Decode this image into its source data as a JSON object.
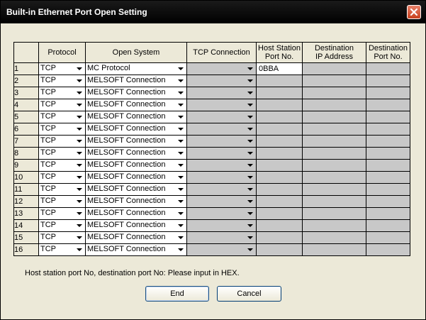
{
  "window": {
    "title": "Built-in Ethernet Port Open Setting"
  },
  "columns": {
    "num": "",
    "protocol": "Protocol",
    "open_system": "Open System",
    "tcp_connection": "TCP Connection",
    "host_port_line1": "Host Station",
    "host_port_line2": "Port No.",
    "dest_ip_line1": "Destination",
    "dest_ip_line2": "IP Address",
    "dest_port_line1": "Destination",
    "dest_port_line2": "Port No."
  },
  "rows": [
    {
      "num": "1",
      "protocol": "TCP",
      "open_system": "MC Protocol",
      "tcp_connection": "",
      "host_port": "0BBA",
      "dest_ip": "",
      "dest_port": ""
    },
    {
      "num": "2",
      "protocol": "TCP",
      "open_system": "MELSOFT Connection",
      "tcp_connection": "",
      "host_port": "",
      "dest_ip": "",
      "dest_port": ""
    },
    {
      "num": "3",
      "protocol": "TCP",
      "open_system": "MELSOFT Connection",
      "tcp_connection": "",
      "host_port": "",
      "dest_ip": "",
      "dest_port": ""
    },
    {
      "num": "4",
      "protocol": "TCP",
      "open_system": "MELSOFT Connection",
      "tcp_connection": "",
      "host_port": "",
      "dest_ip": "",
      "dest_port": ""
    },
    {
      "num": "5",
      "protocol": "TCP",
      "open_system": "MELSOFT Connection",
      "tcp_connection": "",
      "host_port": "",
      "dest_ip": "",
      "dest_port": ""
    },
    {
      "num": "6",
      "protocol": "TCP",
      "open_system": "MELSOFT Connection",
      "tcp_connection": "",
      "host_port": "",
      "dest_ip": "",
      "dest_port": ""
    },
    {
      "num": "7",
      "protocol": "TCP",
      "open_system": "MELSOFT Connection",
      "tcp_connection": "",
      "host_port": "",
      "dest_ip": "",
      "dest_port": ""
    },
    {
      "num": "8",
      "protocol": "TCP",
      "open_system": "MELSOFT Connection",
      "tcp_connection": "",
      "host_port": "",
      "dest_ip": "",
      "dest_port": ""
    },
    {
      "num": "9",
      "protocol": "TCP",
      "open_system": "MELSOFT Connection",
      "tcp_connection": "",
      "host_port": "",
      "dest_ip": "",
      "dest_port": ""
    },
    {
      "num": "10",
      "protocol": "TCP",
      "open_system": "MELSOFT Connection",
      "tcp_connection": "",
      "host_port": "",
      "dest_ip": "",
      "dest_port": ""
    },
    {
      "num": "11",
      "protocol": "TCP",
      "open_system": "MELSOFT Connection",
      "tcp_connection": "",
      "host_port": "",
      "dest_ip": "",
      "dest_port": ""
    },
    {
      "num": "12",
      "protocol": "TCP",
      "open_system": "MELSOFT Connection",
      "tcp_connection": "",
      "host_port": "",
      "dest_ip": "",
      "dest_port": ""
    },
    {
      "num": "13",
      "protocol": "TCP",
      "open_system": "MELSOFT Connection",
      "tcp_connection": "",
      "host_port": "",
      "dest_ip": "",
      "dest_port": ""
    },
    {
      "num": "14",
      "protocol": "TCP",
      "open_system": "MELSOFT Connection",
      "tcp_connection": "",
      "host_port": "",
      "dest_ip": "",
      "dest_port": ""
    },
    {
      "num": "15",
      "protocol": "TCP",
      "open_system": "MELSOFT Connection",
      "tcp_connection": "",
      "host_port": "",
      "dest_ip": "",
      "dest_port": ""
    },
    {
      "num": "16",
      "protocol": "TCP",
      "open_system": "MELSOFT Connection",
      "tcp_connection": "",
      "host_port": "",
      "dest_ip": "",
      "dest_port": ""
    }
  ],
  "note": "Host station port No, destination port No: Please input in HEX.",
  "buttons": {
    "end": "End",
    "cancel": "Cancel"
  },
  "icons": {
    "close": "close-icon",
    "dropdown": "chevron-down-icon"
  },
  "colors": {
    "title_bar": "#000000",
    "close_button": "#d6532f",
    "disabled_cell": "#c8c8c8",
    "dialog_bg": "#ece9d8"
  }
}
